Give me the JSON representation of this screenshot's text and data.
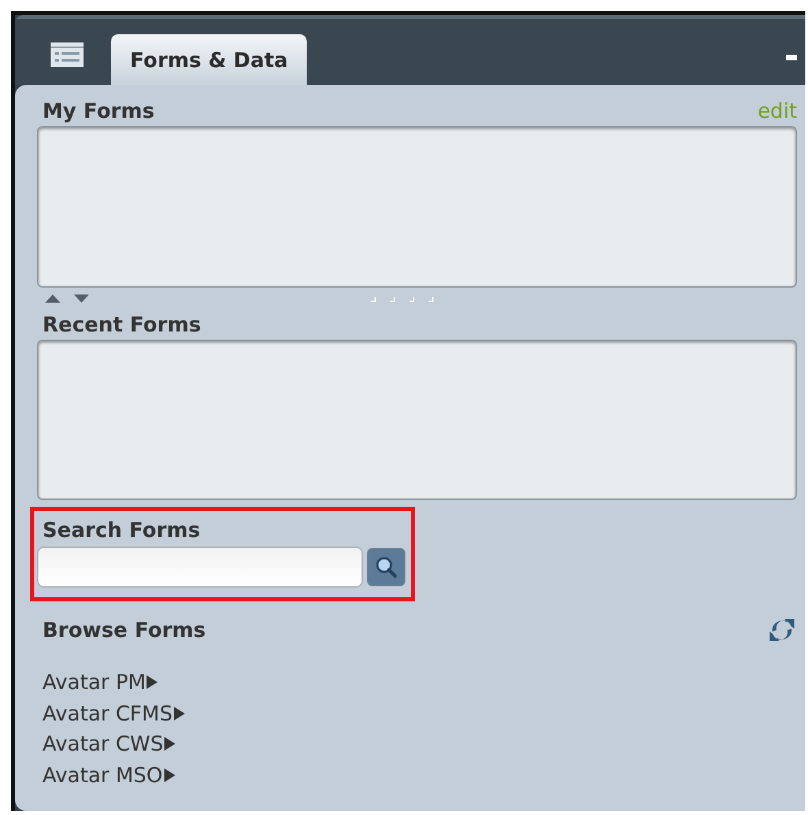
{
  "tab": {
    "label": "Forms & Data"
  },
  "my_forms": {
    "title": "My Forms",
    "edit_link": "edit"
  },
  "recent_forms": {
    "title": "Recent Forms"
  },
  "search": {
    "title": "Search Forms",
    "highlighted": true
  },
  "browse": {
    "title": "Browse Forms",
    "items": [
      {
        "label": "Avatar PM"
      },
      {
        "label": "Avatar CFMS"
      },
      {
        "label": "Avatar CWS"
      },
      {
        "label": "Avatar MSO"
      }
    ]
  }
}
